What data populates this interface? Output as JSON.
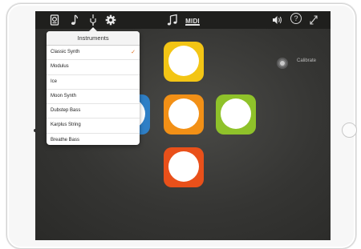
{
  "toolbar": {
    "midi_label": "MIDI",
    "help_glyph": "?",
    "expand_glyph": "⤢",
    "icons": [
      "device-icon",
      "music-note-icon",
      "tuning-fork-icon",
      "gear-icon",
      "music-notes-icon",
      "volume-icon",
      "help-icon",
      "expand-icon"
    ]
  },
  "instruments_menu": {
    "title": "Instruments",
    "items": [
      {
        "label": "Classic Synth",
        "selected": true
      },
      {
        "label": "Modulus",
        "selected": false
      },
      {
        "label": "Ice",
        "selected": false
      },
      {
        "label": "Moon Synth",
        "selected": false
      },
      {
        "label": "Dubstep Bass",
        "selected": false
      },
      {
        "label": "Karplus String",
        "selected": false
      },
      {
        "label": "Breathe Bass",
        "selected": false
      }
    ],
    "check_glyph": "✓",
    "accent_color": "#e07020"
  },
  "pads": [
    {
      "name": "top",
      "color": "#f3c515"
    },
    {
      "name": "left",
      "color": "#2e7fc6"
    },
    {
      "name": "center",
      "color": "#f29016"
    },
    {
      "name": "right",
      "color": "#8fc22a"
    },
    {
      "name": "bottom",
      "color": "#e9501a"
    }
  ],
  "calibrate": {
    "label": "Calibrate"
  }
}
